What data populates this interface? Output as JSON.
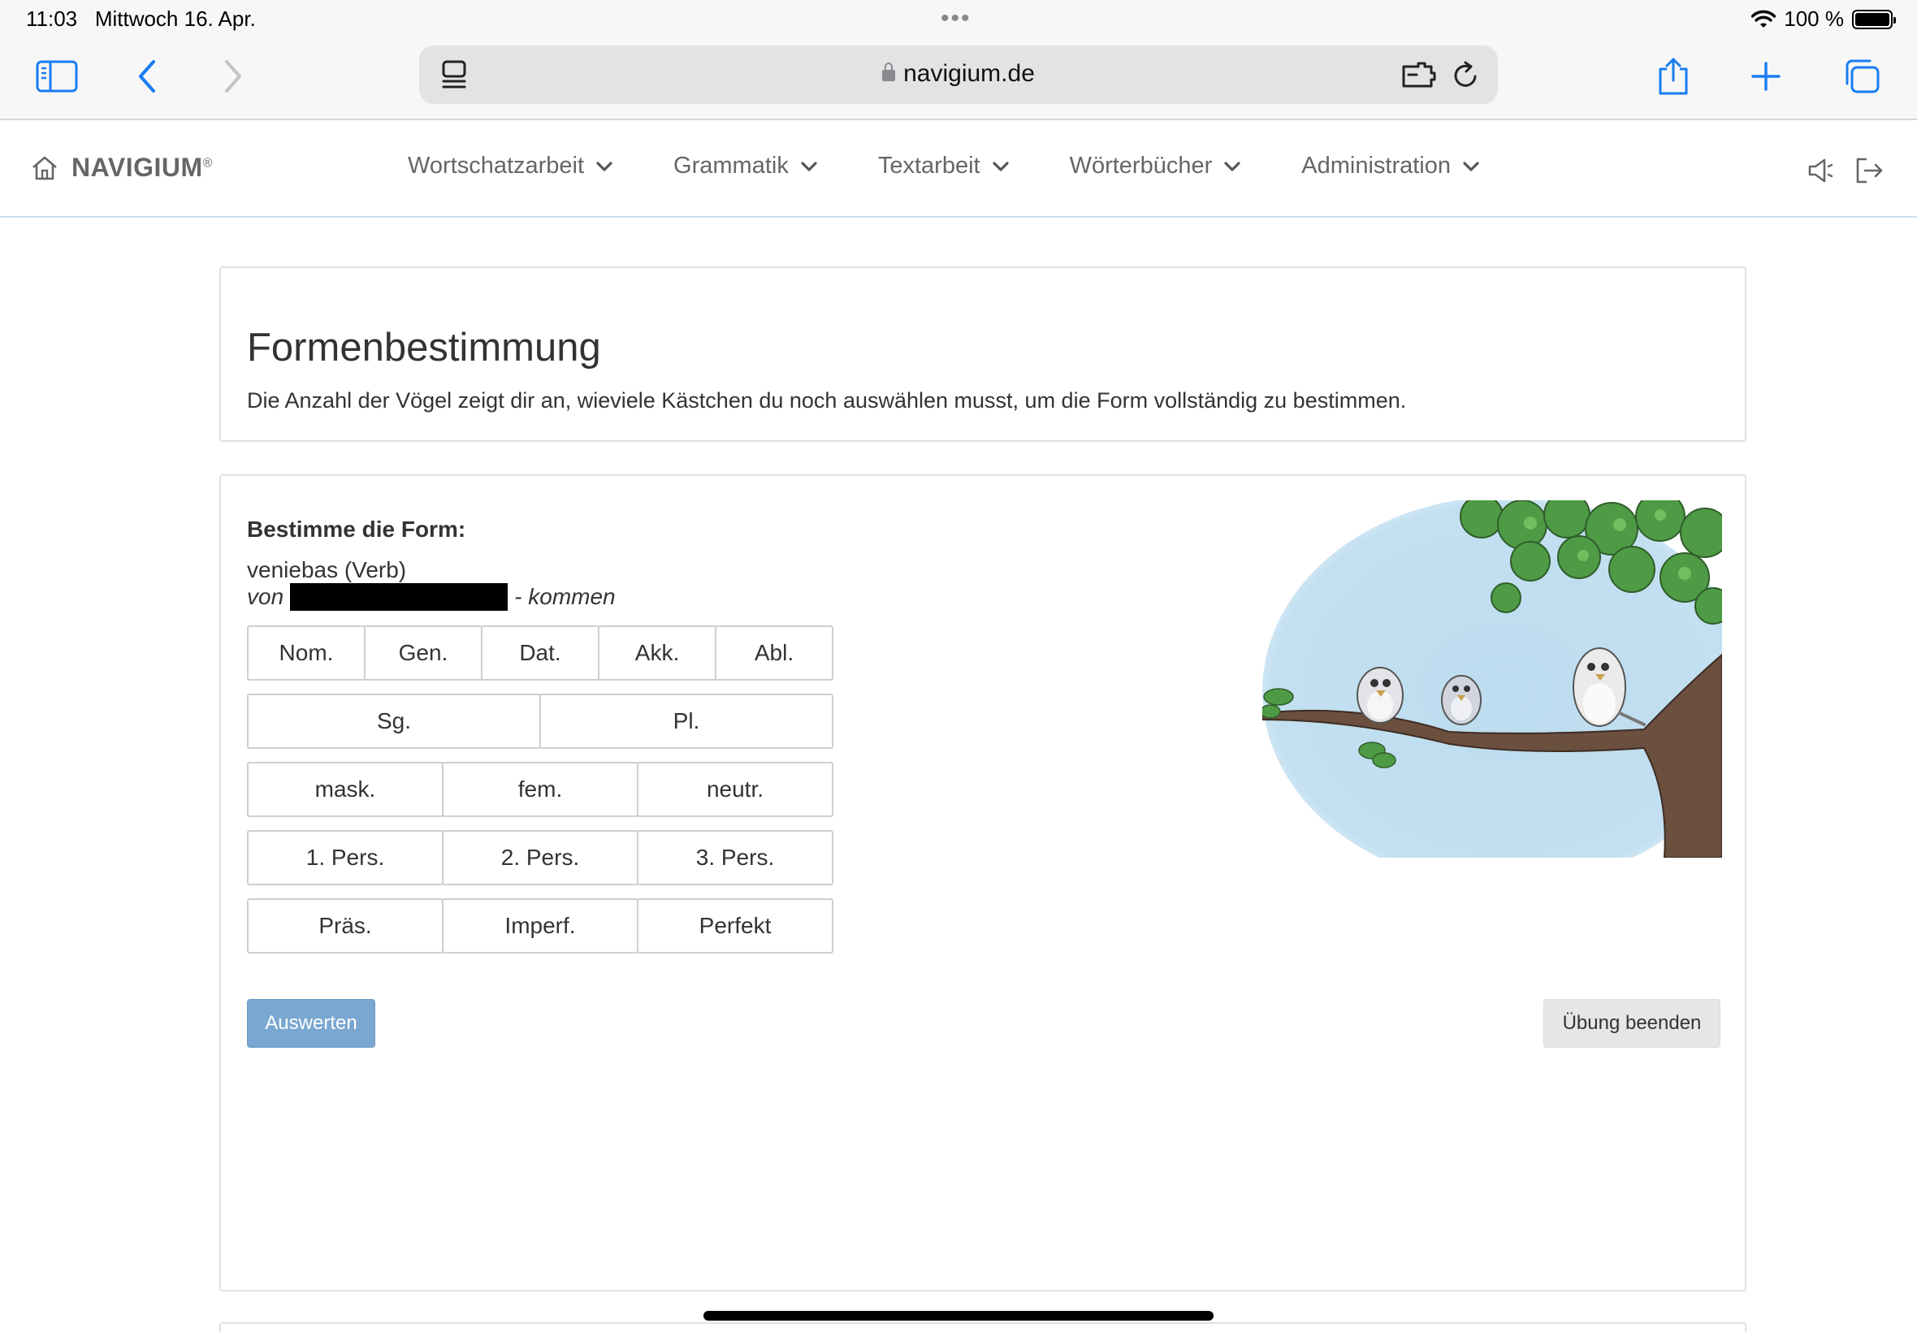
{
  "status": {
    "time": "11:03",
    "date": "Mittwoch 16. Apr.",
    "battery": "100 %"
  },
  "browser": {
    "url": "navigium.de"
  },
  "nav": {
    "brand": "NAVIGIUM",
    "brand_mark": "®",
    "items": [
      {
        "label": "Wortschatzarbeit"
      },
      {
        "label": "Grammatik"
      },
      {
        "label": "Textarbeit"
      },
      {
        "label": "Wörterbücher"
      },
      {
        "label": "Administration"
      }
    ]
  },
  "header": {
    "title": "Formenbestimmung",
    "description": "Die Anzahl der Vögel zeigt dir an, wieviele Kästchen du noch auswählen musst, um die Form vollständig zu bestimmen."
  },
  "task": {
    "label": "Bestimme die Form:",
    "word": "veniebas (Verb)",
    "lemma_prefix": "von",
    "lemma_suffix": "- kommen"
  },
  "options": {
    "cases": [
      "Nom.",
      "Gen.",
      "Dat.",
      "Akk.",
      "Abl."
    ],
    "numbers": [
      "Sg.",
      "Pl."
    ],
    "genders": [
      "mask.",
      "fem.",
      "neutr."
    ],
    "persons": [
      "1. Pers.",
      "2. Pers.",
      "3. Pers."
    ],
    "tenses": [
      "Präs.",
      "Imperf.",
      "Perfekt"
    ]
  },
  "actions": {
    "evaluate": "Auswerten",
    "end": "Übung beenden"
  },
  "colors": {
    "accent_button": "#7aa7d1",
    "nav_border": "#c9dff0",
    "sky": "#bcdcef",
    "leaves": "#4f9a45"
  }
}
